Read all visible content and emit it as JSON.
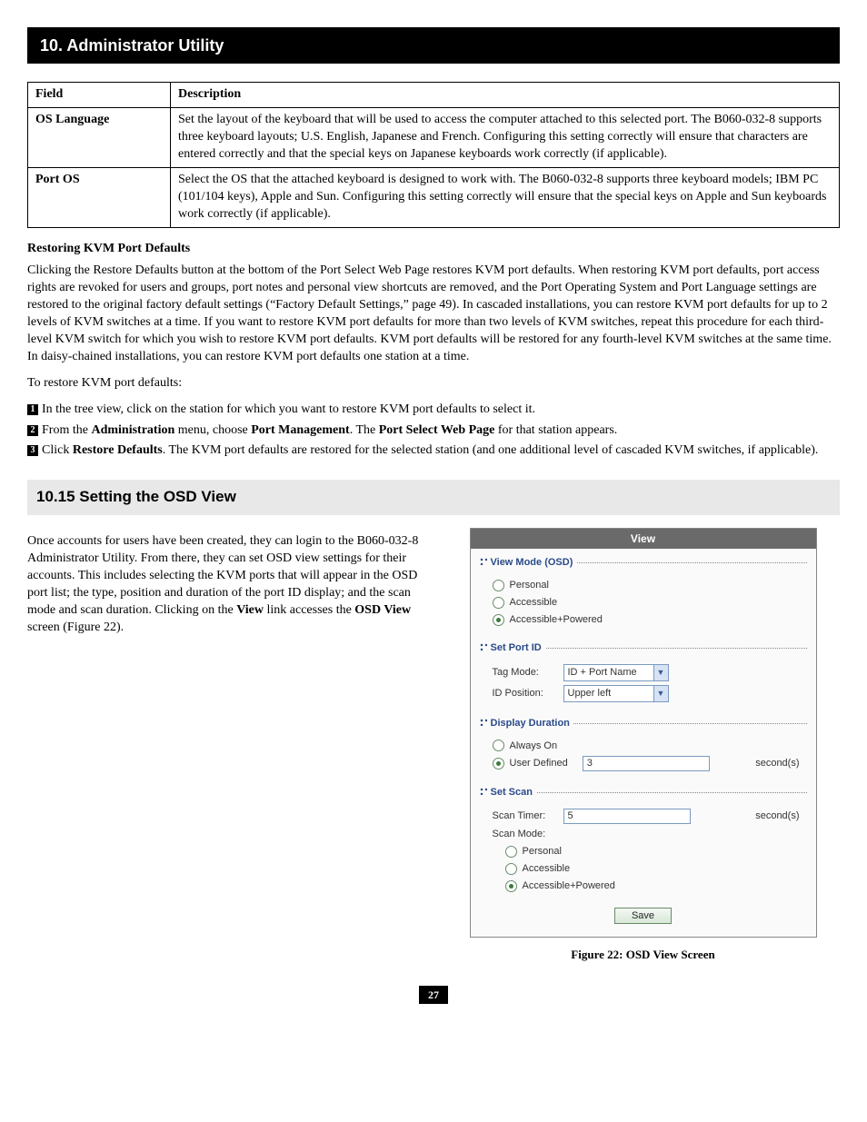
{
  "chapter": "10. Administrator Utility",
  "table": {
    "headers": [
      "Field",
      "Description"
    ],
    "rows": [
      {
        "field": "OS Language",
        "desc": "Set the layout of the keyboard that will be used to access the computer attached to this selected port. The B060-032-8 supports three keyboard layouts; U.S. English, Japanese and French. Configuring this setting correctly will ensure that characters are entered correctly and that the special keys on Japanese keyboards work correctly (if applicable)."
      },
      {
        "field": "Port OS",
        "desc": "Select the OS that the attached keyboard is designed to work with. The B060-032-8 supports three keyboard models; IBM PC (101/104 keys), Apple and Sun. Configuring this setting correctly will ensure that the special keys on Apple and Sun keyboards work correctly (if applicable)."
      }
    ]
  },
  "restore": {
    "heading": "Restoring KVM Port Defaults",
    "para": "Clicking the Restore Defaults button at the bottom of the Port Select Web Page restores KVM port defaults. When restoring KVM port defaults, port access rights are revoked for users and groups, port notes and personal view shortcuts are removed, and the Port Operating System and Port Language settings are restored to the original factory default settings (“Factory Default Settings,” page 49). In cascaded installations, you can restore KVM port defaults for up to 2 levels of KVM switches at a time. If you want to restore KVM port defaults for more than two levels of KVM switches, repeat this procedure for each third-level KVM switch for which you wish to restore KVM port defaults. KVM port defaults will be restored for any fourth-level KVM switches at the same time. In daisy-chained installations, you can restore KVM port defaults one station at a time.",
    "lead": "To restore KVM port defaults:",
    "steps": {
      "s1": "In the tree view, click on the station for which you want to restore KVM port defaults to select it.",
      "s2a": "From the ",
      "s2b_bold": "Administration",
      "s2c": " menu, choose ",
      "s2d_bold": "Port Management",
      "s2e": ". The ",
      "s2f_bold": "Port Select Web Page",
      "s2g": " for that station appears.",
      "s3a": "Click ",
      "s3b_bold": "Restore Defaults",
      "s3c": ". The KVM port defaults are restored for the selected station (and one additional level of cascaded KVM switches, if applicable)."
    }
  },
  "section": {
    "title": "10.15 Setting the OSD View",
    "para_a": "Once accounts for users have been created, they can login to the B060-032-8 Administrator Utility. From there, they can set OSD view settings for their accounts. This includes selecting the KVM ports that will appear in the OSD port list; the type, position and duration of the port ID display; and the scan mode and scan duration. Clicking on the ",
    "para_b_bold": "View",
    "para_c": " link accesses the ",
    "para_d_bold": "OSD View",
    "para_e": " screen (Figure 22)."
  },
  "panel": {
    "title": "View",
    "viewmode": {
      "legend": "View Mode (OSD)",
      "opt1": "Personal",
      "opt2": "Accessible",
      "opt3": "Accessible+Powered",
      "selected": 3
    },
    "setport": {
      "legend": "Set Port ID",
      "tag_label": "Tag Mode:",
      "tag_value": "ID + Port Name",
      "pos_label": "ID Position:",
      "pos_value": "Upper left"
    },
    "duration": {
      "legend": "Display Duration",
      "opt1": "Always On",
      "opt2": "User Defined",
      "value": "3",
      "unit": "second(s)",
      "selected": 2
    },
    "scan": {
      "legend": "Set Scan",
      "timer_label": "Scan Timer:",
      "timer_value": "5",
      "timer_unit": "second(s)",
      "mode_label": "Scan Mode:",
      "opt1": "Personal",
      "opt2": "Accessible",
      "opt3": "Accessible+Powered",
      "selected": 3
    },
    "save": "Save"
  },
  "figure_caption": "Figure 22: OSD View Screen",
  "page_number": "27"
}
